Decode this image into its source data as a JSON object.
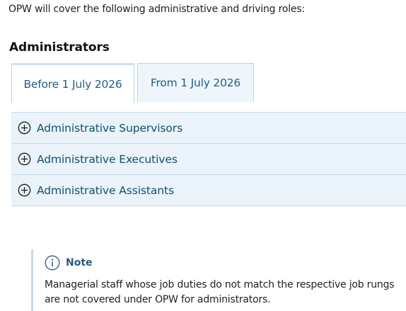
{
  "intro": {
    "text": "OPW will cover the following administrative and driving roles:"
  },
  "section": {
    "heading": "Administrators"
  },
  "tabs": [
    {
      "label": "Before 1 July 2026",
      "active": true
    },
    {
      "label": "From 1 July 2026",
      "active": false
    }
  ],
  "accordion": {
    "icon": "plus-circle-icon",
    "items": [
      {
        "label": "Administrative Supervisors"
      },
      {
        "label": "Administrative Executives"
      },
      {
        "label": "Administrative Assistants"
      }
    ]
  },
  "note": {
    "icon": "info-circle-icon",
    "title": "Note",
    "body": "Managerial staff whose job duties do not match the respective job rungs are not covered under OPW for administrators."
  },
  "colors": {
    "link": "#1e5f85",
    "accordion_bg": "#e9f3f9",
    "border": "#c9dce8"
  }
}
